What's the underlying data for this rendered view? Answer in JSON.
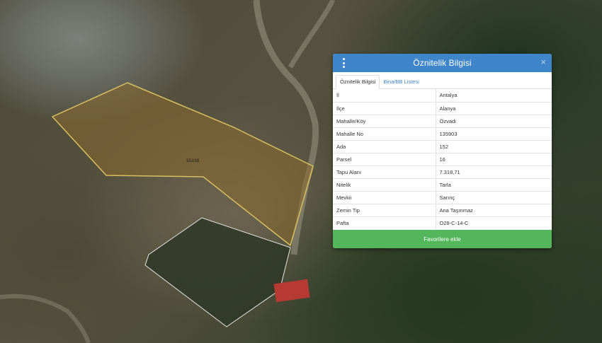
{
  "map": {
    "parcel_label": "152/16"
  },
  "panel": {
    "title": "Öznitelik Bilgisi",
    "close_glyph": "×",
    "tabs": [
      {
        "label": "Öznitelik Bilgisi",
        "active": true
      },
      {
        "label": "Bina/BB Listesi",
        "active": false
      }
    ],
    "rows": [
      {
        "key": "İl",
        "value": "Antalya"
      },
      {
        "key": "İlçe",
        "value": "Alanya"
      },
      {
        "key": "Mahalle/Köy",
        "value": "Özvadi"
      },
      {
        "key": "Mahalle No",
        "value": "135903"
      },
      {
        "key": "Ada",
        "value": "152"
      },
      {
        "key": "Parsel",
        "value": "16"
      },
      {
        "key": "Tapu Alanı",
        "value": "7.318,71"
      },
      {
        "key": "Nitelik",
        "value": "Tarla"
      },
      {
        "key": "Mevkii",
        "value": "Sarınç"
      },
      {
        "key": "Zemin Tip",
        "value": "Ana Taşınmaz"
      },
      {
        "key": "Pafta",
        "value": "O28-C-14-C"
      }
    ],
    "favorite_button": "Favorilere ekle"
  },
  "colors": {
    "header": "#3f85c9",
    "button": "#53b65b",
    "parcel_outline": "#d8c060"
  },
  "icons": {
    "menu": "vertical-dots-icon",
    "close": "close-icon"
  }
}
